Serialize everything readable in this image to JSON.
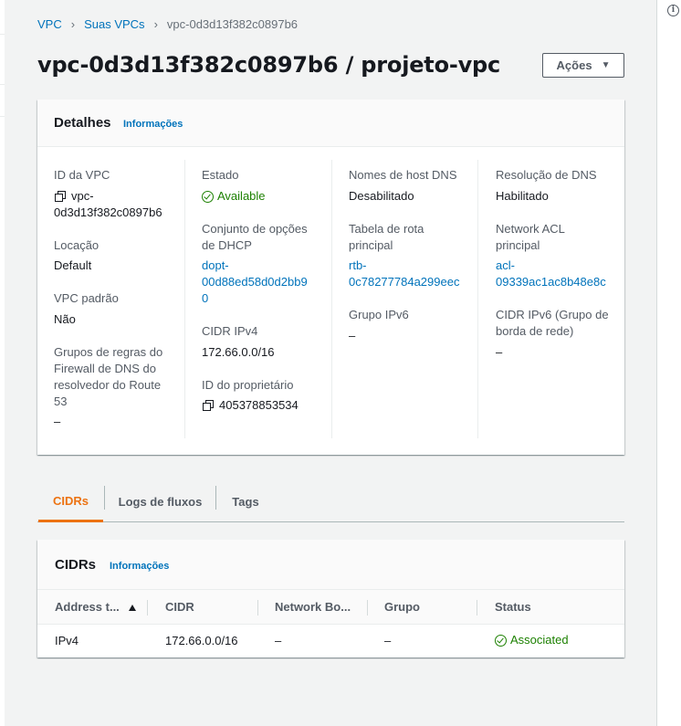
{
  "breadcrumb": {
    "items": [
      "VPC",
      "Suas VPCs"
    ],
    "current": "vpc-0d3d13f382c0897b6"
  },
  "page_title": "vpc-0d3d13f382c0897b6 / projeto-vpc",
  "actions_label": "Ações",
  "details": {
    "title": "Detalhes",
    "info_label": "Informações",
    "col1": {
      "vpc_id_label": "ID da VPC",
      "vpc_id_line1": "vpc-",
      "vpc_id_line2": "0d3d13f382c0897b6",
      "location_label": "Locação",
      "location_value": "Default",
      "default_vpc_label": "VPC padrão",
      "default_vpc_value": "Não",
      "dns_fw_label_1": "Grupos de regras do",
      "dns_fw_label_2": "Firewall de DNS do",
      "dns_fw_label_3": "resolvedor do Route",
      "dns_fw_label_4": "53",
      "dns_fw_value": "–"
    },
    "col2": {
      "state_label": "Estado",
      "state_value": "Available",
      "dhcp_label_1": "Conjunto de opções",
      "dhcp_label_2": "de DHCP",
      "dhcp_link_1": "dopt-",
      "dhcp_link_2": "00d88ed58d0d2bb9",
      "dhcp_link_3": "0",
      "cidr_ipv4_label": "CIDR IPv4",
      "cidr_ipv4_value": "172.66.0.0/16",
      "owner_label": "ID do proprietário",
      "owner_value": "405378853534"
    },
    "col3": {
      "dns_host_label": "Nomes de host DNS",
      "dns_host_value": "Desabilitado",
      "route_table_label_1": "Tabela de rota",
      "route_table_label_2": "principal",
      "route_table_link_1": "rtb-",
      "route_table_link_2": "0c78277784a299eec",
      "ipv6_group_label": "Grupo IPv6",
      "ipv6_group_value": "–"
    },
    "col4": {
      "dns_res_label": "Resolução de DNS",
      "dns_res_value": "Habilitado",
      "acl_label_1": "Network ACL",
      "acl_label_2": "principal",
      "acl_link_1": "acl-",
      "acl_link_2": "09339ac1ac8b48e8c",
      "cidr_ipv6_label_1": "CIDR IPv6 (Grupo de",
      "cidr_ipv6_label_2": "borda de rede)",
      "cidr_ipv6_value": "–"
    }
  },
  "tabs": [
    "CIDRs",
    "Logs de fluxos",
    "Tags"
  ],
  "cidrs": {
    "title": "CIDRs",
    "info_label": "Informações",
    "columns": [
      "Address t...",
      "CIDR",
      "Network Bo...",
      "Grupo",
      "Status"
    ],
    "rows": [
      {
        "address_type": "IPv4",
        "cidr": "172.66.0.0/16",
        "network_border": "–",
        "group": "–",
        "status": "Associated"
      }
    ]
  },
  "colors": {
    "link": "#0073bb",
    "success": "#1d8102",
    "active_tab": "#ec7211"
  }
}
